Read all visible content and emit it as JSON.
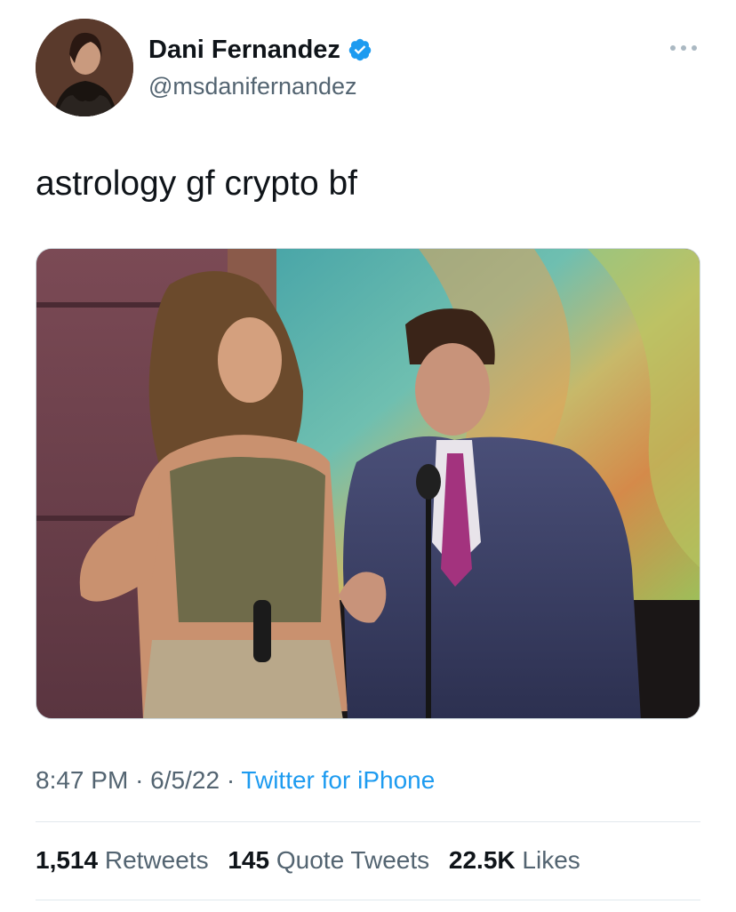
{
  "author": {
    "display_name": "Dani Fernandez",
    "handle": "@msdanifernandez",
    "verified_color": "#1d9bf0"
  },
  "tweet": {
    "text": "astrology gf crypto bf"
  },
  "meta": {
    "time": "8:47 PM",
    "date": "6/5/22",
    "source": "Twitter for iPhone"
  },
  "stats": {
    "retweets": {
      "count": "1,514",
      "label": "Retweets"
    },
    "quote_tweets": {
      "count": "145",
      "label": "Quote Tweets"
    },
    "likes": {
      "count": "22.5K",
      "label": "Likes"
    }
  }
}
